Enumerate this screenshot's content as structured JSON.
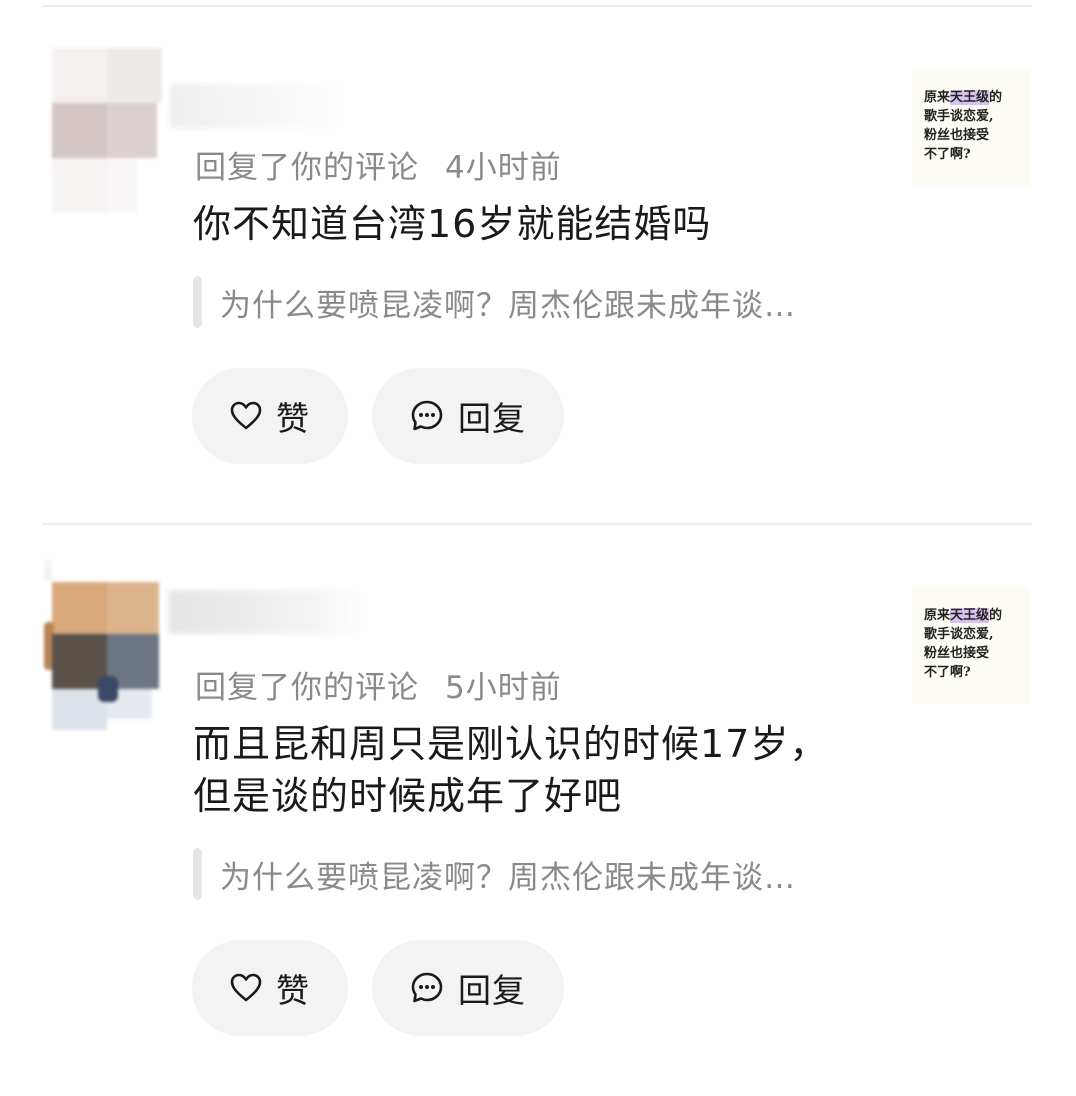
{
  "notifications": [
    {
      "action": "回复了你的评论",
      "time": "4小时前",
      "body_lines": [
        "你不知道台湾16岁就能结婚吗"
      ],
      "quote": "为什么要喷昆凌啊？周杰伦跟未成年谈…",
      "like_label": "赞",
      "reply_label": "回复",
      "thumbnail": {
        "line1_prefix": "原来",
        "line1_highlight": "天王级",
        "line1_suffix": "的",
        "line2": "歌手谈恋爱,",
        "line3": "粉丝也接受",
        "line4": "不了啊?"
      }
    },
    {
      "action": "回复了你的评论",
      "time": "5小时前",
      "body_lines": [
        "而且昆和周只是刚认识的时候17岁，",
        "但是谈的时候成年了好吧"
      ],
      "quote": "为什么要喷昆凌啊？周杰伦跟未成年谈…",
      "like_label": "赞",
      "reply_label": "回复",
      "thumbnail": {
        "line1_prefix": "原来",
        "line1_highlight": "天王级",
        "line1_suffix": "的",
        "line2": "歌手谈恋爱,",
        "line3": "粉丝也接受",
        "line4": "不了啊?"
      }
    }
  ],
  "icons": {
    "like": "heart-outline-icon",
    "reply": "chat-bubble-icon"
  },
  "colors": {
    "meta_text": "#8a8a8a",
    "button_bg": "#f3f3f3",
    "thumb_highlight": "#d8c3f0"
  }
}
